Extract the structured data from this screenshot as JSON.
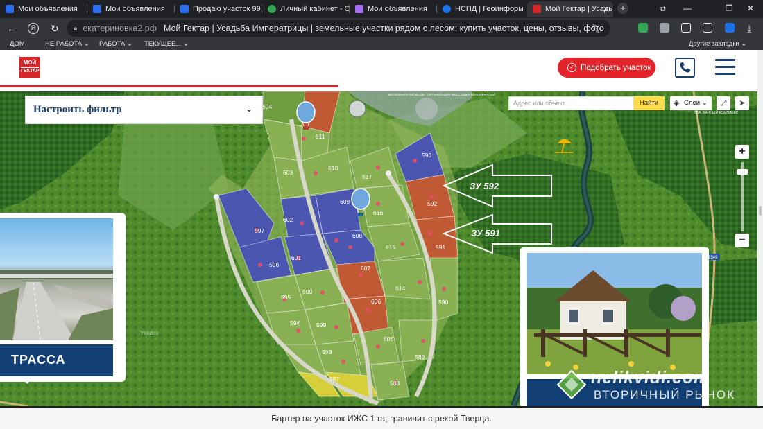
{
  "browser": {
    "tabs": [
      {
        "label": "Мои объявления",
        "fav_color": "#2d6ff2"
      },
      {
        "label": "Мои объявления",
        "fav_color": "#2d6ff2"
      },
      {
        "label": "Продаю участок 99.9",
        "fav_color": "#2d6ff2"
      },
      {
        "label": "Личный кабинет - Об",
        "fav_color": "#34a853"
      },
      {
        "label": "Мои объявления",
        "fav_color": "#a56cf5"
      },
      {
        "label": "НСПД | Геоинформац",
        "fav_color": "#1a73e8"
      },
      {
        "label": "Мой Гектар | Усадь",
        "fav_color": "#d6262a"
      }
    ],
    "active_tab_index": 6,
    "url_host": "екатериновка2.рф",
    "page_title": "Мой Гектар | Усадьба Императрицы | земельные участки рядом с лесом: купить участок, цены, отзывы, фото",
    "bookmarks": [
      "ДОМ",
      "НЕ РАБОТА",
      "РАБОТА",
      "ТЕКУЩЕЕ...",
      "Другие закладки"
    ]
  },
  "site": {
    "logo_top": "МОЙ",
    "logo_bottom": "ГЕКТАР",
    "cta_label": "Подобрать участок",
    "filter_label": "Настроить фильтр"
  },
  "map": {
    "search_placeholder": "Адрес или объект",
    "find_label": "Найти",
    "layers_label": "Слои",
    "yandex_label": "Yandex",
    "road_number": "1549",
    "arrow_labels": [
      "ЗУ 592",
      "ЗУ 591"
    ],
    "plots": [
      "604",
      "611",
      "603",
      "610",
      "617",
      "593",
      "609",
      "602",
      "597",
      "616",
      "592",
      "608",
      "601",
      "596",
      "615",
      "591",
      "607",
      "614",
      "595",
      "600",
      "606",
      "590",
      "594",
      "599",
      "605",
      "589",
      "598",
      "587",
      "588"
    ],
    "poi_text": "ВЕРХОВНАЯ ПЛОЩАДЬ ПРОГУЛОЧНАЯ ЗОНА ОРГАНИЗАЦИЯ МАССОВЫХ МЕРОПРИЯТИЙ",
    "spa_text": "СПА, БАННЫЙ КОМПЛЕКС"
  },
  "cards": {
    "left_caption": "ТРАССА",
    "right_caption": ""
  },
  "watermark": {
    "top": "nelikvidi.com",
    "bottom": "ВТОРИЧНЫЙ РЫНОК"
  },
  "caption": "Бартер на участок ИЖС 1 га, граничит с рекой Тверца."
}
